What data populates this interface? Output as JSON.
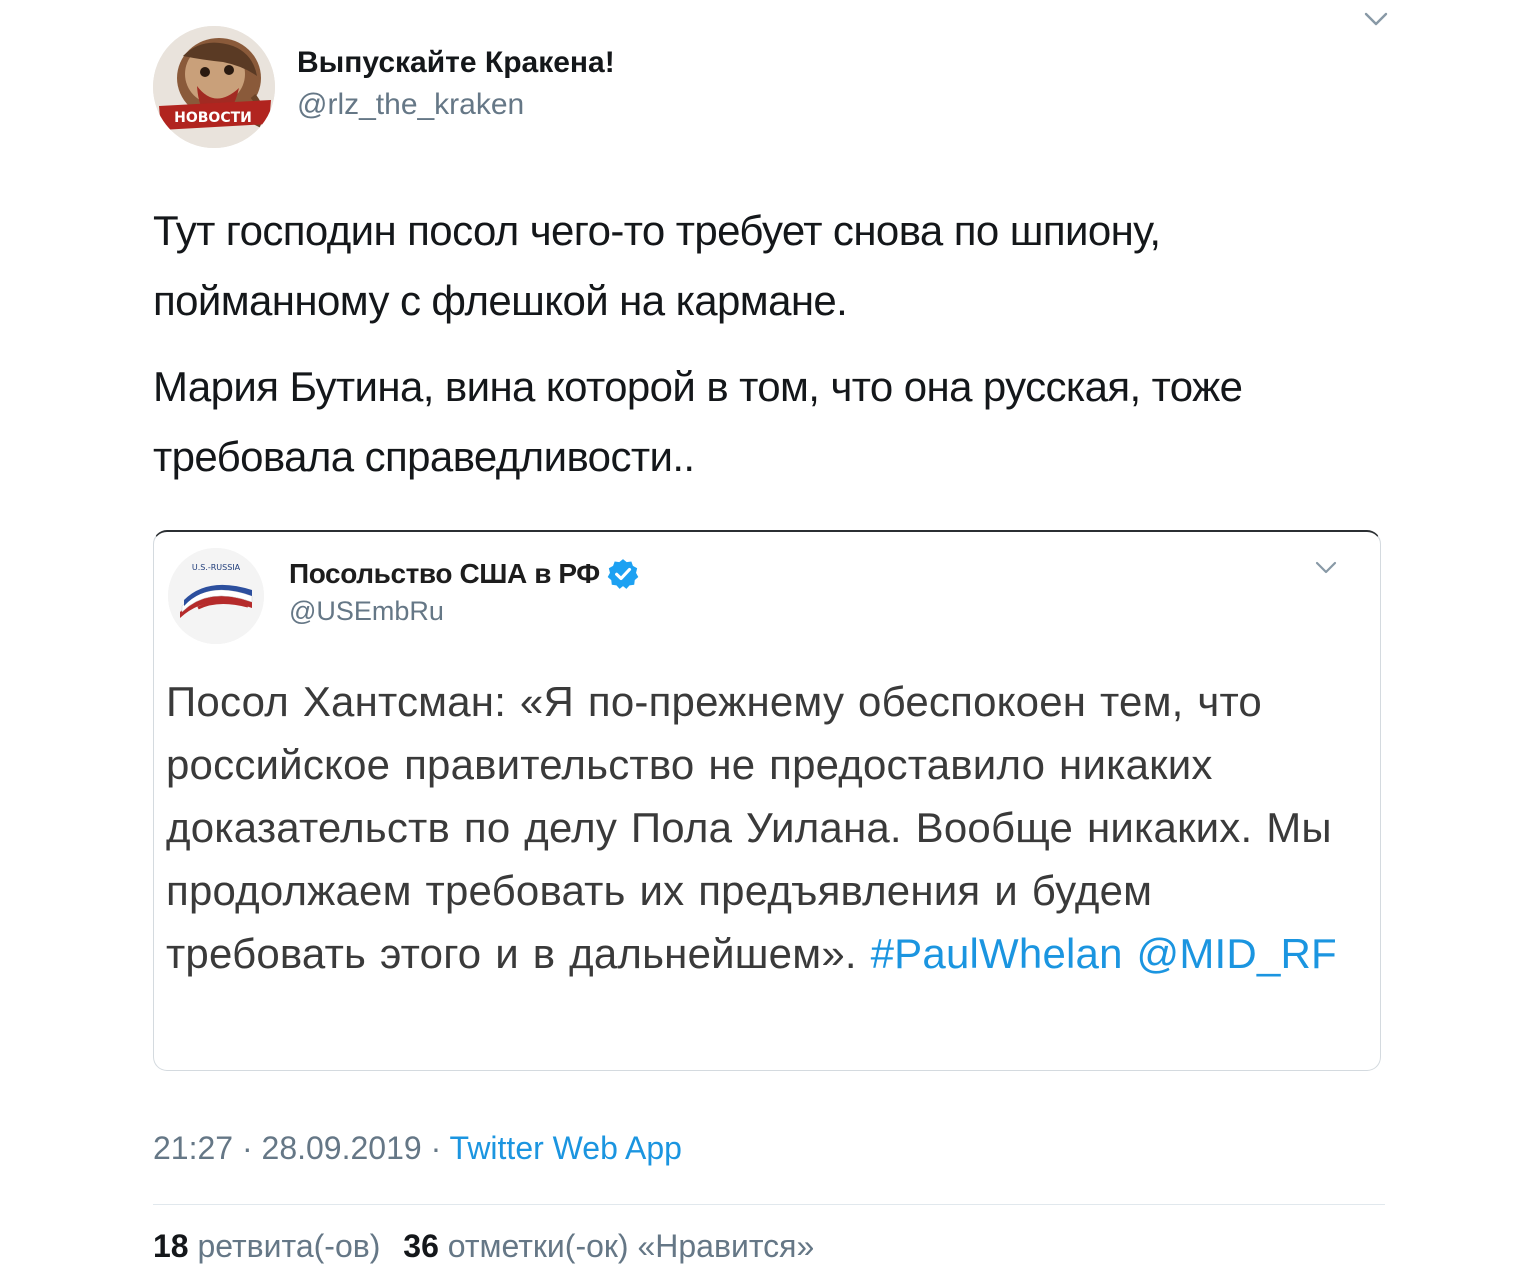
{
  "author": {
    "name": "Выпускайте Кракена!",
    "handle": "@rlz_the_kraken",
    "avatar_label": "НОВОСТИ"
  },
  "tweet": {
    "paragraphs": [
      "Тут господин посол чего-то требует снова по шпиону, пойманному с флешкой на кармане.",
      "Мария Бутина, вина которой в том, что она русская, тоже требовала справедливости.."
    ]
  },
  "quoted": {
    "name": "Посольство США в РФ",
    "handle": "@USEmbRu",
    "avatar_label": "U.S.-RUSSIA",
    "verified": true,
    "text_plain": "Посол Хантсман: «Я по-прежнему обеспокоен тем, что российское правительство не предоставило никаких доказательств по делу Пола Уилана. Вообще никаких. Мы продолжаем требовать их предъявления и будем требовать этого и в дальнейшем».",
    "hashtag": "#PaulWhelan",
    "mention": "@MID_RF"
  },
  "meta": {
    "time": "21:27",
    "date": "28.09.2019",
    "separator": " · ",
    "source": "Twitter Web App"
  },
  "stats": {
    "retweets_count": "18",
    "retweets_label": "ретвита(-ов)",
    "likes_count": "36",
    "likes_label": "отметки(-ок) «Нравится»"
  },
  "colors": {
    "text": "#14171a",
    "secondary": "#657786",
    "link": "#1b95e0",
    "divider": "#e1e8ed"
  },
  "icons": {
    "caret": "chevron-down-icon",
    "verified": "verified-badge-icon"
  }
}
